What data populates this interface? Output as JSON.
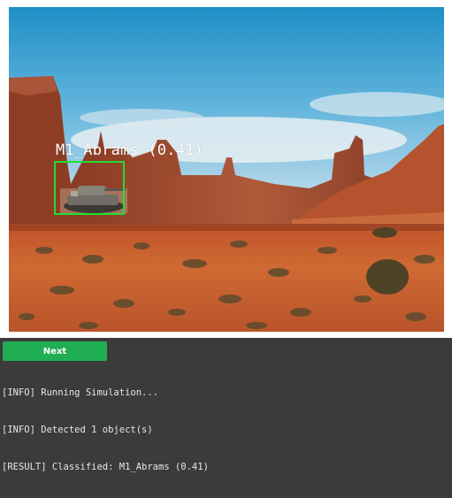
{
  "detection": {
    "label": "M1_Abrams (0.41)",
    "box_color": "#22dd33"
  },
  "controls": {
    "next_label": "Next",
    "next_color": "#1fae53"
  },
  "log": {
    "lines": [
      "[INFO] Running Simulation...",
      "[INFO] Detected 1 object(s)",
      "[RESULT] Classified: M1_Abrams (0.41)"
    ]
  }
}
